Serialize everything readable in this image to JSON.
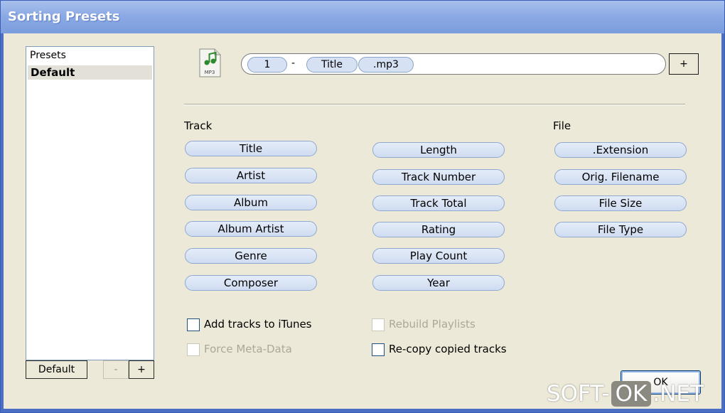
{
  "window": {
    "title": "Sorting Presets"
  },
  "presets": {
    "header": "Presets",
    "items": [
      "Default"
    ],
    "default_button": "Default",
    "remove_button": "-",
    "add_button": "+"
  },
  "pattern": {
    "icon_label": "MP3",
    "tokens": [
      {
        "text": "1"
      },
      {
        "text": "-"
      },
      {
        "text": "Title"
      },
      {
        "text": ".mp3"
      }
    ],
    "add_button": "+"
  },
  "track": {
    "label": "Track",
    "column1": [
      "Title",
      "Artist",
      "Album",
      "Album Artist",
      "Genre",
      "Composer"
    ],
    "column2": [
      "Length",
      "Track Number",
      "Track Total",
      "Rating",
      "Play Count",
      "Year"
    ]
  },
  "file": {
    "label": "File",
    "items": [
      ".Extension",
      "Orig. Filename",
      "File Size",
      "File Type"
    ]
  },
  "options": {
    "add_to_itunes": {
      "label": "Add tracks to iTunes",
      "checked": false,
      "enabled": true
    },
    "force_meta": {
      "label": "Force Meta-Data",
      "checked": false,
      "enabled": false
    },
    "rebuild_playlists": {
      "label": "Rebuild Playlists",
      "checked": false,
      "enabled": false
    },
    "recopy": {
      "label": "Re-copy copied tracks",
      "checked": false,
      "enabled": true
    }
  },
  "ok_button": "OK",
  "watermark": {
    "left": "SOFT-",
    "middle": "OK",
    "right": ".NET"
  }
}
